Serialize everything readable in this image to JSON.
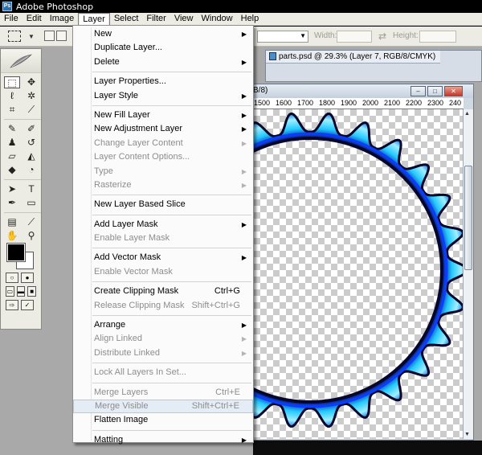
{
  "app": {
    "title": "Adobe Photoshop"
  },
  "menubar": [
    "File",
    "Edit",
    "Image",
    "Layer",
    "Select",
    "Filter",
    "View",
    "Window",
    "Help"
  ],
  "options": {
    "width_label": "Width:",
    "height_label": "Height:",
    "width_value": "",
    "height_value": ""
  },
  "document": {
    "tab_title": "parts.psd @ 29.3% (Layer 7, RGB/8/CMYK)",
    "front_title_partial": "B/8)",
    "ruler_labels": [
      "1500",
      "1600",
      "1700",
      "1800",
      "1900",
      "2000",
      "2100",
      "2200",
      "2300",
      "240"
    ]
  },
  "layer_menu": {
    "items": [
      {
        "label": "New",
        "submenu": true,
        "enabled": true
      },
      {
        "label": "Duplicate Layer...",
        "enabled": true
      },
      {
        "label": "Delete",
        "submenu": true,
        "enabled": true
      },
      {
        "separator": true
      },
      {
        "label": "Layer Properties...",
        "enabled": true
      },
      {
        "label": "Layer Style",
        "submenu": true,
        "enabled": true
      },
      {
        "separator": true
      },
      {
        "label": "New Fill Layer",
        "submenu": true,
        "enabled": true
      },
      {
        "label": "New Adjustment Layer",
        "submenu": true,
        "enabled": true
      },
      {
        "label": "Change Layer Content",
        "submenu": true,
        "enabled": false
      },
      {
        "label": "Layer Content Options...",
        "enabled": false
      },
      {
        "label": "Type",
        "submenu": true,
        "enabled": false
      },
      {
        "label": "Rasterize",
        "submenu": true,
        "enabled": false
      },
      {
        "separator": true
      },
      {
        "label": "New Layer Based Slice",
        "enabled": true
      },
      {
        "separator": true
      },
      {
        "label": "Add Layer Mask",
        "submenu": true,
        "enabled": true
      },
      {
        "label": "Enable Layer Mask",
        "enabled": false
      },
      {
        "separator": true
      },
      {
        "label": "Add Vector Mask",
        "submenu": true,
        "enabled": true
      },
      {
        "label": "Enable Vector Mask",
        "enabled": false
      },
      {
        "separator": true
      },
      {
        "label": "Create Clipping Mask",
        "shortcut": "Ctrl+G",
        "enabled": true
      },
      {
        "label": "Release Clipping Mask",
        "shortcut": "Shift+Ctrl+G",
        "enabled": false
      },
      {
        "separator": true
      },
      {
        "label": "Arrange",
        "submenu": true,
        "enabled": true
      },
      {
        "label": "Align Linked",
        "submenu": true,
        "enabled": false
      },
      {
        "label": "Distribute Linked",
        "submenu": true,
        "enabled": false
      },
      {
        "separator": true
      },
      {
        "label": "Lock All Layers In Set...",
        "enabled": false
      },
      {
        "separator": true
      },
      {
        "label": "Merge Layers",
        "shortcut": "Ctrl+E",
        "enabled": false
      },
      {
        "label": "Merge Visible",
        "shortcut": "Shift+Ctrl+E",
        "enabled": false,
        "highlighted": true
      },
      {
        "label": "Flatten Image",
        "enabled": true
      },
      {
        "separator": true
      },
      {
        "label": "Matting",
        "submenu": true,
        "enabled": true
      }
    ]
  },
  "colors": {
    "foreground": "#000000",
    "background": "#ffffff",
    "gear_fill": "#22c8ff",
    "gear_outline": "#05062a"
  },
  "icons": {
    "submenu": "▶",
    "dropdown": "▼",
    "swap": "⇄"
  }
}
